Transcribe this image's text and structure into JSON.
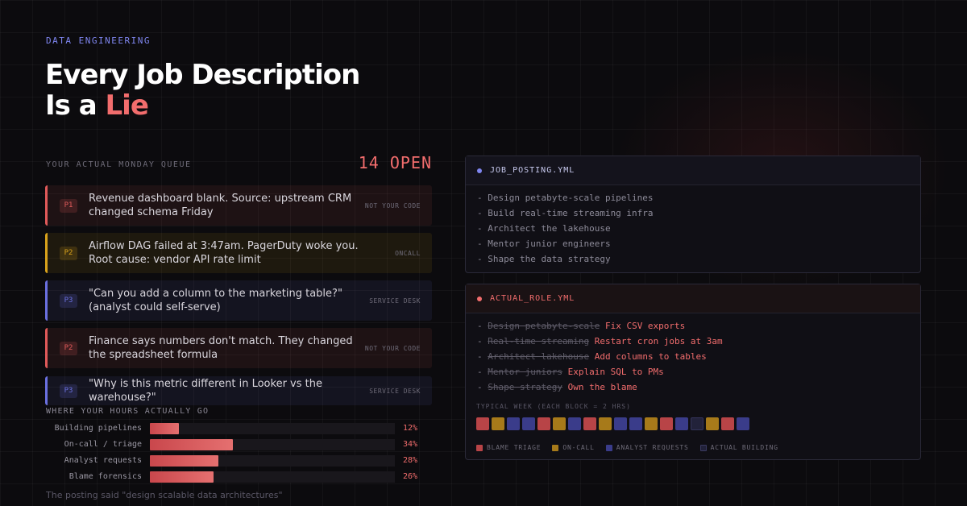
{
  "eyebrow": "DATA ENGINEERING",
  "headline": {
    "line1": "Every Job Description",
    "line2_prefix": "Is a ",
    "line2_accent": "Lie"
  },
  "queue": {
    "label": "YOUR ACTUAL MONDAY QUEUE",
    "count": "14 OPEN",
    "tickets": [
      {
        "priority": "P1",
        "text": "Revenue dashboard blank. Source: upstream CRM changed schema Friday",
        "note": "NOT YOUR CODE",
        "color": "#e05a5a"
      },
      {
        "priority": "P2",
        "text": "Airflow DAG failed at 3:47am. PagerDuty woke you. Root cause: vendor API rate limit",
        "note": "ONCALL",
        "color": "#d9a21b"
      },
      {
        "priority": "P3",
        "text": "\"Can you add a column to the marketing table?\" (analyst could self-serve)",
        "note": "SERVICE DESK",
        "color": "#6a70e0"
      },
      {
        "priority": "P2",
        "text": "Finance says numbers don't match. They changed the spreadsheet formula",
        "note": "NOT YOUR CODE",
        "color": "#e05a5a"
      },
      {
        "priority": "P3",
        "text": "\"Why is this metric different in Looker vs the warehouse?\"",
        "note": "SERVICE DESK",
        "color": "#6a70e0"
      }
    ]
  },
  "hours": {
    "label": "WHERE YOUR HOURS ACTUALLY GO",
    "rows": [
      {
        "name": "Building pipelines",
        "pct_label": "12%",
        "fraction": 0.12
      },
      {
        "name": "On-call / triage",
        "pct_label": "34%",
        "fraction": 0.34
      },
      {
        "name": "Analyst requests",
        "pct_label": "28%",
        "fraction": 0.28
      },
      {
        "name": "Blame forensics",
        "pct_label": "26%",
        "fraction": 0.26
      }
    ],
    "footnote": "The posting said \"design scalable data architectures\""
  },
  "job_posting": {
    "title": "JOB_POSTING.YML",
    "dot_color": "#7f86f0",
    "lines": [
      "- Design petabyte-scale pipelines",
      "- Build real-time streaming infra",
      "- Architect the lakehouse",
      "- Mentor junior engineers",
      "- Shape the data strategy"
    ]
  },
  "actual_role": {
    "title": "ACTUAL_ROLE.YML",
    "dot_color": "#f26d6d",
    "lines": [
      {
        "struck": "Design petabyte-scale",
        "real": "Fix CSV exports"
      },
      {
        "struck": "Real-time streaming",
        "real": "Restart cron jobs at 3am"
      },
      {
        "struck": "Architect lakehouse",
        "real": "Add columns to tables"
      },
      {
        "struck": "Mentor juniors",
        "real": "Explain SQL to PMs"
      },
      {
        "struck": "Shape strategy",
        "real": "Own the blame"
      }
    ],
    "week_label": "TYPICAL WEEK (EACH BLOCK = 2 HRS)",
    "week_blocks": [
      "blame",
      "oncall",
      "analyst",
      "analyst",
      "blame",
      "oncall",
      "analyst",
      "blame",
      "oncall",
      "analyst",
      "analyst",
      "oncall",
      "blame",
      "analyst",
      "building",
      "oncall",
      "blame",
      "analyst"
    ],
    "legend": [
      {
        "key": "blame",
        "label": "BLAME TRIAGE",
        "color": "#b84447"
      },
      {
        "key": "oncall",
        "label": "ON-CALL",
        "color": "#a77a1a"
      },
      {
        "key": "analyst",
        "label": "ANALYST REQUESTS",
        "color": "#3a3c8a"
      },
      {
        "key": "building",
        "label": "ACTUAL BUILDING",
        "color": "#22223a"
      }
    ]
  }
}
